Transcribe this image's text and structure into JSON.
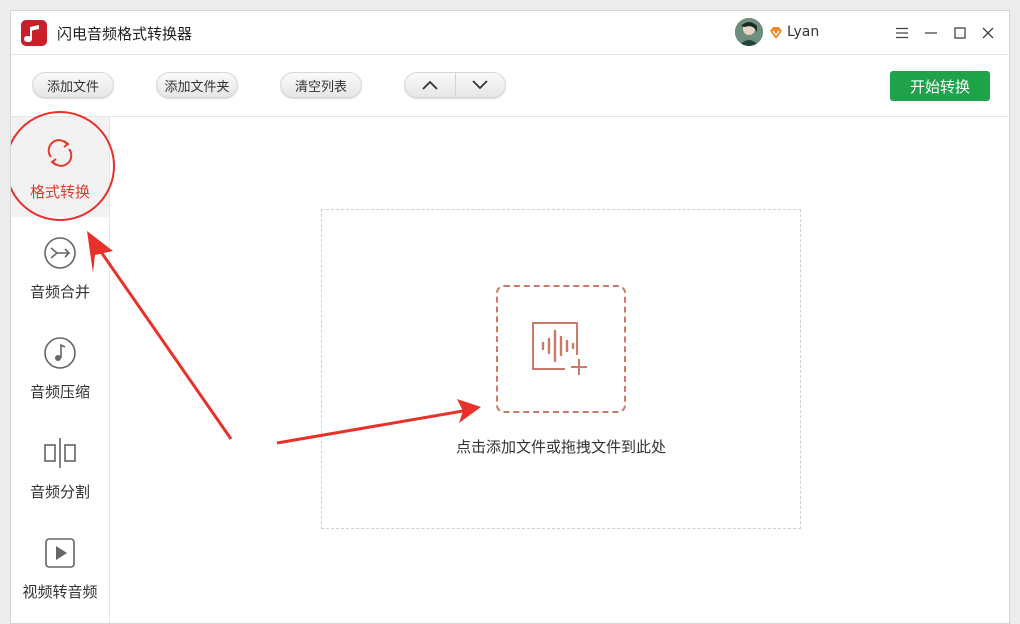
{
  "app": {
    "title": "闪电音频格式转换器"
  },
  "user": {
    "name": "Lyan",
    "avatar": "avatar-icon",
    "badge": "vip-diamond-icon"
  },
  "window_controls": {
    "menu": "menu-icon",
    "minimize": "minimize-icon",
    "maximize": "maximize-icon",
    "close": "close-icon"
  },
  "toolbar": {
    "add_file": "添加文件",
    "add_folder": "添加文件夹",
    "clear_list": "清空列表",
    "move_up": "chevron-up-icon",
    "move_down": "chevron-down-icon",
    "start": "开始转换"
  },
  "sidebar": {
    "items": [
      {
        "label": "格式转换",
        "icon": "refresh-icon",
        "active": true
      },
      {
        "label": "音频合并",
        "icon": "merge-icon",
        "active": false
      },
      {
        "label": "音频压缩",
        "icon": "music-note-icon",
        "active": false
      },
      {
        "label": "音频分割",
        "icon": "split-icon",
        "active": false
      },
      {
        "label": "视频转音频",
        "icon": "play-icon",
        "active": false
      }
    ]
  },
  "dropzone": {
    "hint": "点击添加文件或拖拽文件到此处",
    "icon": "audio-add-icon"
  },
  "colors": {
    "accent_red": "#e23a2f",
    "start_green": "#1fa34a",
    "add_box": "#c97a68",
    "annotation": "#e8312a"
  }
}
